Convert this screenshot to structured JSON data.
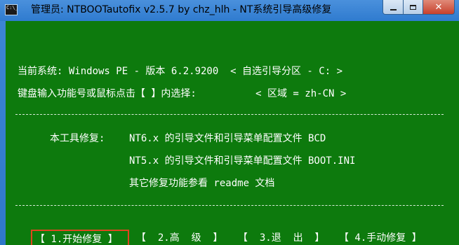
{
  "window": {
    "title": "管理员:  NTBOOTautofix v2.5.7 by chz_hlh - NT系统引导高级修复",
    "icon_text": "C:\\_",
    "icon_name": "console-app-icon",
    "minimize_icon": "minimize-icon",
    "maximize_icon": "maximize-icon",
    "close_glyph": "✕",
    "title_bar_color": "#3d86d6",
    "close_color": "#c7402c"
  },
  "console": {
    "background_color": "#0d7a0d",
    "text_color": "#ffffff",
    "system_line": "当前系统: Windows PE - 版本 6.2.9200  < 自选引导分区 - C: >",
    "prompt_line": "键盘输入功能号或鼠标点击【 】内选择:          < 区域 = zh-CN >",
    "repair_label": "本工具修复:",
    "repair_items": [
      "NT6.x 的引导文件和引导菜单配置文件 BCD",
      "NT5.x 的引导文件和引导菜单配置文件 BOOT.INI",
      "其它修复功能参看 readme 文档"
    ]
  },
  "menu": {
    "selected_color": "#e0451f",
    "items": [
      {
        "label": "【 1.开始修复 】"
      },
      {
        "label": "【  2.高  级  】"
      },
      {
        "label": "【  3.退  出  】"
      },
      {
        "label": "【 4.手动修复 】"
      }
    ]
  }
}
